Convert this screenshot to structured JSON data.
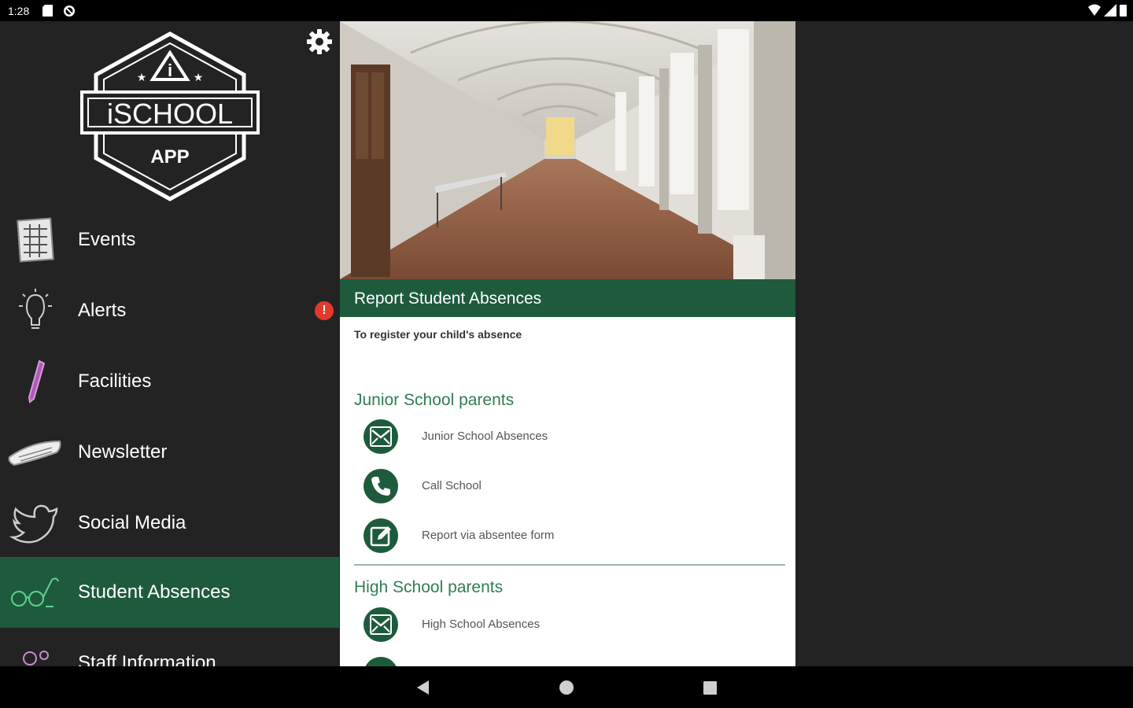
{
  "status_bar": {
    "time": "1:28"
  },
  "logo": {
    "name": "iSCHOOL",
    "sub": "APP",
    "mark": "i"
  },
  "sidebar": {
    "items": [
      {
        "label": "Events",
        "icon": "calendar-icon"
      },
      {
        "label": "Alerts",
        "icon": "lightbulb-icon",
        "badge": "!"
      },
      {
        "label": "Facilities",
        "icon": "pencil-icon"
      },
      {
        "label": "Newsletter",
        "icon": "newspaper-icon"
      },
      {
        "label": "Social Media",
        "icon": "twitter-bird-icon"
      },
      {
        "label": "Student Absences",
        "icon": "glasses-icon",
        "active": true
      },
      {
        "label": "Staff Information",
        "icon": "staff-icon"
      }
    ]
  },
  "main": {
    "header": "Report Student Absences",
    "intro": "To register your child's absence",
    "sections": [
      {
        "title": "Junior School parents",
        "items": [
          {
            "label": "Junior School Absences",
            "icon": "email-icon"
          },
          {
            "label": "Call School",
            "icon": "phone-icon"
          },
          {
            "label": "Report via absentee form",
            "icon": "edit-form-icon"
          }
        ]
      },
      {
        "title": "High School parents",
        "items": [
          {
            "label": "High School Absences",
            "icon": "email-icon"
          }
        ]
      }
    ]
  },
  "colors": {
    "accent_green": "#1e5b3d",
    "section_title_green": "#2e7d55",
    "background_dark": "#232323",
    "alert_red": "#e03a2b"
  }
}
